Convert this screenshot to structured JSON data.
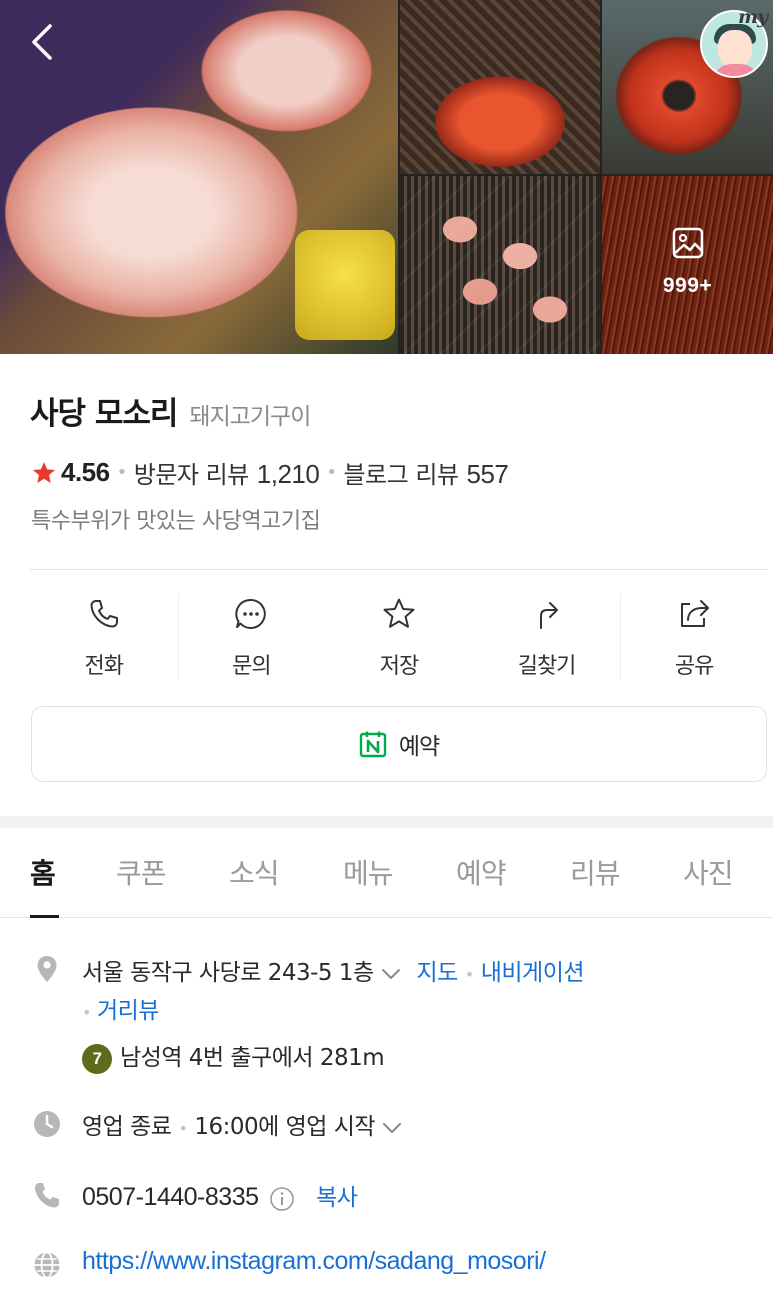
{
  "gallery": {
    "photo_count_label": "999+",
    "profile_badge": "my"
  },
  "place": {
    "name": "사당 모소리",
    "category": "돼지고기구이",
    "rating": "4.56",
    "visitor_review_label": "방문자 리뷰",
    "visitor_review_count": "1,210",
    "blog_review_label": "블로그 리뷰",
    "blog_review_count": "557",
    "description": "특수부위가 맛있는 사당역고기집",
    "star_color": "#e8392e"
  },
  "actions": {
    "call": "전화",
    "inquiry": "문의",
    "save": "저장",
    "directions": "길찾기",
    "share": "공유"
  },
  "reservation": {
    "label": "예약",
    "icon_color": "#03a94d"
  },
  "tabs": [
    "홈",
    "쿠폰",
    "소식",
    "메뉴",
    "예약",
    "리뷰",
    "사진"
  ],
  "info": {
    "address": "서울 동작구 사당로 243-5 1층",
    "map_link": "지도",
    "navigation_link": "내비게이션",
    "street_view_link": "거리뷰",
    "subway_line": "7",
    "subway_directions": "남성역 4번 출구에서 281m",
    "hours_status": "영업 종료",
    "hours_detail": "16:00에 영업 시작",
    "phone": "0507-1440-8335",
    "copy_link": "복사",
    "website": "https://www.instagram.com/sadang_mosori/"
  },
  "colors": {
    "link": "#1a6fd6",
    "subway_line_7": "#5e6b1d"
  }
}
